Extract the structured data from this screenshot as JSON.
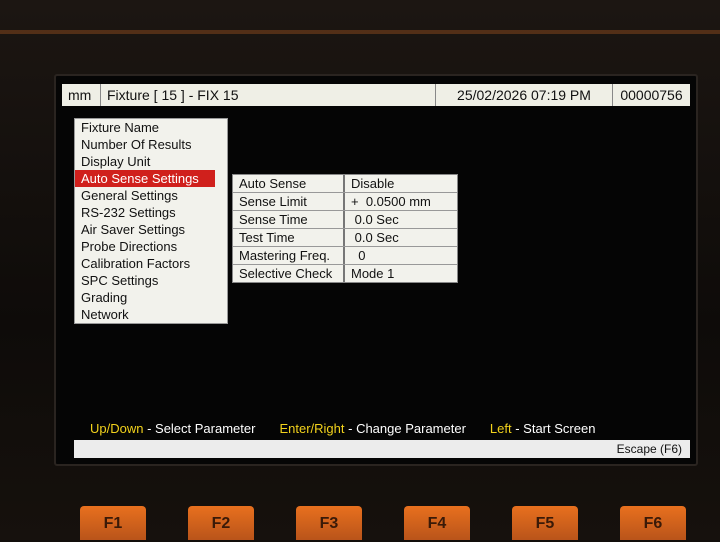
{
  "topbar": {
    "unit": "mm",
    "fixture": "Fixture [ 15 ] - FIX  15",
    "datetime": "25/02/2026  07:19 PM",
    "counter": "00000756"
  },
  "menu": {
    "items": [
      {
        "label": "Fixture Name"
      },
      {
        "label": "Number Of Results"
      },
      {
        "label": "Display Unit"
      },
      {
        "label": "Auto Sense Settings",
        "active": true
      },
      {
        "label": "General Settings"
      },
      {
        "label": "RS-232 Settings"
      },
      {
        "label": "Air Saver Settings"
      },
      {
        "label": "Probe Directions"
      },
      {
        "label": "Calibration Factors"
      },
      {
        "label": "SPC Settings"
      },
      {
        "label": "Grading"
      },
      {
        "label": "Network"
      }
    ]
  },
  "params": {
    "rows": [
      {
        "name": "Auto Sense",
        "value": "Disable"
      },
      {
        "name": "Sense Limit",
        "value": "+  0.0500 mm"
      },
      {
        "name": "Sense Time",
        "value": " 0.0 Sec"
      },
      {
        "name": "Test Time",
        "value": " 0.0 Sec"
      },
      {
        "name": "Mastering Freq.",
        "value": "  0"
      },
      {
        "name": "Selective Check",
        "value": "Mode 1"
      }
    ]
  },
  "help": {
    "select_key": "Up/Down",
    "select_text": " - Select Parameter",
    "change_key": "Enter/Right",
    "change_text": " - Change Parameter",
    "left_key": "Left",
    "left_text": " - Start Screen"
  },
  "status": {
    "escape": "Escape (F6)"
  },
  "fkeys": [
    "F1",
    "F2",
    "F3",
    "F4",
    "F5",
    "F6"
  ],
  "colors": {
    "active_item": "#d0201c",
    "help_key": "#f2d21c",
    "fkey": "#e8701e"
  }
}
